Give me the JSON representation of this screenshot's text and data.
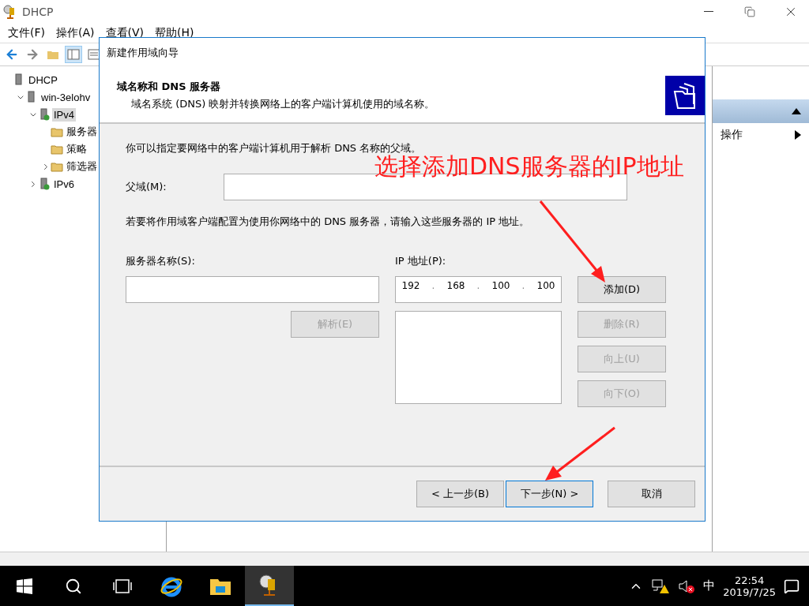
{
  "window": {
    "title": "DHCP"
  },
  "menu": [
    "文件(F)",
    "操作(A)",
    "查看(V)",
    "帮助(H)"
  ],
  "tree": [
    {
      "label": "DHCP",
      "selected": false,
      "children": [
        {
          "label": "win-3elohv",
          "selected": false,
          "expanded": true,
          "children": [
            {
              "label": "IPv4",
              "selected": true,
              "expanded": true,
              "children": [
                {
                  "label": "服务器",
                  "selected": false
                },
                {
                  "label": "策略",
                  "selected": false
                },
                {
                  "label": "筛选器",
                  "selected": false,
                  "expanded": false
                }
              ]
            },
            {
              "label": "IPv6",
              "selected": false,
              "expanded": false
            }
          ]
        }
      ]
    }
  ],
  "actions_panel": {
    "items": [
      {
        "label": "操作"
      }
    ]
  },
  "dialog": {
    "title": "新建作用域向导",
    "heading": "域名称和 DNS 服务器",
    "subheading": "域名系统 (DNS) 映射并转换网络上的客户端计算机使用的域名称。",
    "intro": "你可以指定要网络中的客户端计算机用于解析 DNS 名称的父域。",
    "parent_domain": {
      "label": "父域(M):"
    },
    "dns_intro": "若要将作用域客户端配置为使用你网络中的 DNS 服务器，请输入这些服务器的 IP 地址。",
    "server_name": {
      "label": "服务器名称(S):"
    },
    "ip_address": {
      "label": "IP 地址(P):",
      "octets": [
        "192",
        "168",
        "100",
        "100"
      ],
      "separator": "."
    },
    "resolve_button": {
      "label": "解析(E)",
      "disabled": true
    },
    "side_buttons": [
      {
        "label": "添加(D)",
        "disabled": false
      },
      {
        "label": "删除(R)",
        "disabled": true
      },
      {
        "label": "向上(U)",
        "disabled": true
      },
      {
        "label": "向下(O)",
        "disabled": true
      }
    ],
    "footer_buttons": [
      {
        "label": "< 上一步(B)",
        "default": false
      },
      {
        "label": "下一步(N) >",
        "default": true
      },
      {
        "label": "取消",
        "default": false
      }
    ]
  },
  "annotation": {
    "text": "选择添加DNS服务器的IP地址"
  },
  "taskbar": {
    "ime": "中",
    "time": "22:54",
    "date": "2019/7/25"
  }
}
